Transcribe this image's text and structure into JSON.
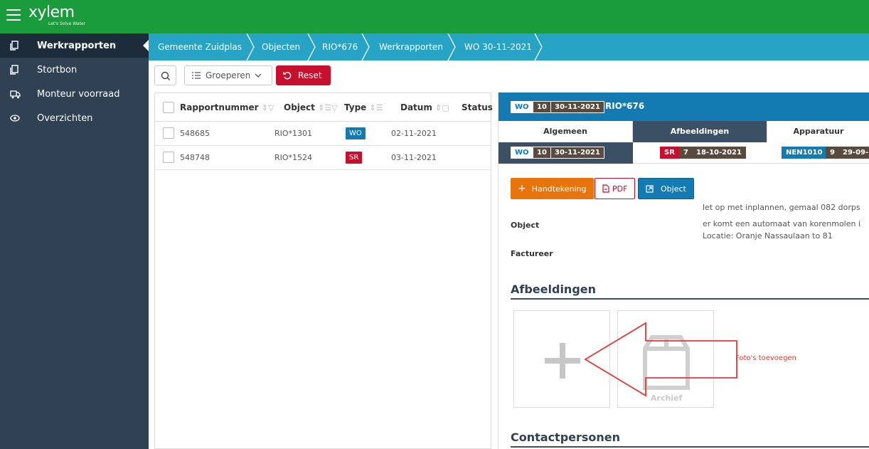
{
  "app": {
    "brand": "xylem",
    "tagline": "Let's Solve Water"
  },
  "sidebar": {
    "items": [
      {
        "label": "Werkrapporten",
        "icon": "copy-icon",
        "active": true
      },
      {
        "label": "Stortbon",
        "icon": "copy-icon",
        "active": false
      },
      {
        "label": "Monteur voorraad",
        "icon": "truck-icon",
        "active": false
      },
      {
        "label": "Overzichten",
        "icon": "eye-icon",
        "active": false
      }
    ]
  },
  "breadcrumb": [
    "Gemeente Zuidplas",
    "Objecten",
    "RIO*676",
    "Werkrapporten",
    "WO 30-11-2021"
  ],
  "toolbar": {
    "group_label": "Groeperen",
    "reset_label": "Reset"
  },
  "table": {
    "columns": [
      "Rapportnummer",
      "Object",
      "Type",
      "Datum",
      "Status"
    ],
    "rows": [
      {
        "number": "548685",
        "object": "RIO*1301",
        "type": "WO",
        "type_color": "#137bb2",
        "date": "02-11-2021"
      },
      {
        "number": "548748",
        "object": "RIO*1524",
        "type": "SR",
        "type_color": "#c8102e",
        "date": "03-11-2021"
      }
    ]
  },
  "detail": {
    "header": {
      "type": "WO",
      "num": "10",
      "date": "30-11-2021",
      "object": "RIO*676"
    },
    "tabs": [
      "Algemeen",
      "Afbeeldingen",
      "Apparatuur"
    ],
    "subtabs": [
      {
        "type": "WO",
        "num": "10",
        "date": "30-11-2021"
      },
      {
        "type": "SR",
        "num": "7",
        "date": "18-10-2021"
      },
      {
        "type": "NEN1010",
        "num": "9",
        "date": "29-09-"
      }
    ],
    "buttons": {
      "handtekening": "Handtekening",
      "pdf": "PDF",
      "object": "Object"
    },
    "object_label": "Object",
    "factureer_label": "Factureer",
    "note_line1": "let op met inplannen, gemaal 082 dorps",
    "note_line2": "er komt een automaat van korenmolen i",
    "note_line3": "Locatie: Oranje Nassaulaan to 81",
    "images_title": "Afbeeldingen",
    "archive_label": "Archief",
    "annotation": "Foto's toevoegen",
    "contacts_title": "Contactpersonen"
  },
  "colors": {
    "topbar": "#1a9b3c",
    "sidebar": "#2f4153",
    "breadcrumb": "#27a3c5",
    "detail_header": "#137bb2",
    "reset": "#c8102e",
    "handtekening": "#e8750c",
    "annotation": "#e53935"
  }
}
